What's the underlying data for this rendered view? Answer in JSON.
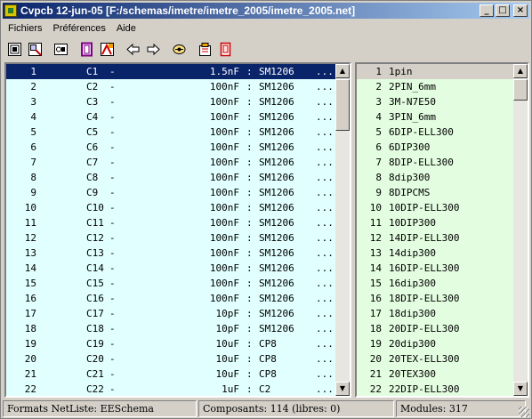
{
  "window": {
    "title": "Cvpcb 12-jun-05 [F:/schemas/imetre/imetre_2005/imetre_2005.net]",
    "buttons": {
      "minimize": "_",
      "maximize": "□",
      "close": "×"
    }
  },
  "menu": [
    {
      "label": "Fichiers"
    },
    {
      "label": "Préférences"
    },
    {
      "label": "Aide"
    }
  ],
  "toolbar": {
    "tools": [
      {
        "name": "open-netlist-icon"
      },
      {
        "name": "save-netlist-icon"
      },
      {
        "name": "create-component-file-icon"
      },
      {
        "name": "config-libs-icon"
      },
      {
        "name": "view-footprint-icon"
      },
      {
        "name": "previous-unassigned-icon"
      },
      {
        "name": "next-unassigned-icon"
      },
      {
        "name": "auto-associate-icon"
      },
      {
        "name": "delete-associations-icon"
      },
      {
        "name": "documentation-icon"
      }
    ]
  },
  "components": [
    {
      "num": "1",
      "ref": "C1",
      "dash": "-",
      "value": "1.5nF",
      "sep": ":",
      "footprint": "SM1206",
      "more": "..."
    },
    {
      "num": "2",
      "ref": "C2",
      "dash": "-",
      "value": "100nF",
      "sep": ":",
      "footprint": "SM1206",
      "more": "..."
    },
    {
      "num": "3",
      "ref": "C3",
      "dash": "-",
      "value": "100nF",
      "sep": ":",
      "footprint": "SM1206",
      "more": "..."
    },
    {
      "num": "4",
      "ref": "C4",
      "dash": "-",
      "value": "100nF",
      "sep": ":",
      "footprint": "SM1206",
      "more": "..."
    },
    {
      "num": "5",
      "ref": "C5",
      "dash": "-",
      "value": "100nF",
      "sep": ":",
      "footprint": "SM1206",
      "more": "..."
    },
    {
      "num": "6",
      "ref": "C6",
      "dash": "-",
      "value": "100nF",
      "sep": ":",
      "footprint": "SM1206",
      "more": "..."
    },
    {
      "num": "7",
      "ref": "C7",
      "dash": "-",
      "value": "100nF",
      "sep": ":",
      "footprint": "SM1206",
      "more": "..."
    },
    {
      "num": "8",
      "ref": "C8",
      "dash": "-",
      "value": "100nF",
      "sep": ":",
      "footprint": "SM1206",
      "more": "..."
    },
    {
      "num": "9",
      "ref": "C9",
      "dash": "-",
      "value": "100nF",
      "sep": ":",
      "footprint": "SM1206",
      "more": "..."
    },
    {
      "num": "10",
      "ref": "C10",
      "dash": "-",
      "value": "100nF",
      "sep": ":",
      "footprint": "SM1206",
      "more": "..."
    },
    {
      "num": "11",
      "ref": "C11",
      "dash": "-",
      "value": "100nF",
      "sep": ":",
      "footprint": "SM1206",
      "more": "..."
    },
    {
      "num": "12",
      "ref": "C12",
      "dash": "-",
      "value": "100nF",
      "sep": ":",
      "footprint": "SM1206",
      "more": "..."
    },
    {
      "num": "13",
      "ref": "C13",
      "dash": "-",
      "value": "100nF",
      "sep": ":",
      "footprint": "SM1206",
      "more": "..."
    },
    {
      "num": "14",
      "ref": "C14",
      "dash": "-",
      "value": "100nF",
      "sep": ":",
      "footprint": "SM1206",
      "more": "..."
    },
    {
      "num": "15",
      "ref": "C15",
      "dash": "-",
      "value": "100nF",
      "sep": ":",
      "footprint": "SM1206",
      "more": "..."
    },
    {
      "num": "16",
      "ref": "C16",
      "dash": "-",
      "value": "100nF",
      "sep": ":",
      "footprint": "SM1206",
      "more": "..."
    },
    {
      "num": "17",
      "ref": "C17",
      "dash": "-",
      "value": "10pF",
      "sep": ":",
      "footprint": "SM1206",
      "more": "..."
    },
    {
      "num": "18",
      "ref": "C18",
      "dash": "-",
      "value": "10pF",
      "sep": ":",
      "footprint": "SM1206",
      "more": "..."
    },
    {
      "num": "19",
      "ref": "C19",
      "dash": "-",
      "value": "10uF",
      "sep": ":",
      "footprint": "CP8",
      "more": "..."
    },
    {
      "num": "20",
      "ref": "C20",
      "dash": "-",
      "value": "10uF",
      "sep": ":",
      "footprint": "CP8",
      "more": "..."
    },
    {
      "num": "21",
      "ref": "C21",
      "dash": "-",
      "value": "10uF",
      "sep": ":",
      "footprint": "CP8",
      "more": "..."
    },
    {
      "num": "22",
      "ref": "C22",
      "dash": "-",
      "value": "1uF",
      "sep": ":",
      "footprint": "C2",
      "more": "..."
    }
  ],
  "modules": [
    {
      "num": "1",
      "name": "1pin"
    },
    {
      "num": "2",
      "name": "2PIN_6mm"
    },
    {
      "num": "3",
      "name": "3M-N7E50"
    },
    {
      "num": "4",
      "name": "3PIN_6mm"
    },
    {
      "num": "5",
      "name": "6DIP-ELL300"
    },
    {
      "num": "6",
      "name": "6DIP300"
    },
    {
      "num": "7",
      "name": "8DIP-ELL300"
    },
    {
      "num": "8",
      "name": "8dip300"
    },
    {
      "num": "9",
      "name": "8DIPCMS"
    },
    {
      "num": "10",
      "name": "10DIP-ELL300"
    },
    {
      "num": "11",
      "name": "10DIP300"
    },
    {
      "num": "12",
      "name": "14DIP-ELL300"
    },
    {
      "num": "13",
      "name": "14dip300"
    },
    {
      "num": "14",
      "name": "16DIP-ELL300"
    },
    {
      "num": "15",
      "name": "16dip300"
    },
    {
      "num": "16",
      "name": "18DIP-ELL300"
    },
    {
      "num": "17",
      "name": "18dip300"
    },
    {
      "num": "18",
      "name": "20DIP-ELL300"
    },
    {
      "num": "19",
      "name": "20dip300"
    },
    {
      "num": "20",
      "name": "20TEX-ELL300"
    },
    {
      "num": "21",
      "name": "20TEX300"
    },
    {
      "num": "22",
      "name": "22DIP-ELL300"
    }
  ],
  "scroll": {
    "arrow_up": "▲",
    "arrow_down": "▼"
  },
  "status": {
    "format": "Formats NetListe: EESchema",
    "components": "Composants: 114 (libres: 0)",
    "modules": "Modules: 317"
  }
}
